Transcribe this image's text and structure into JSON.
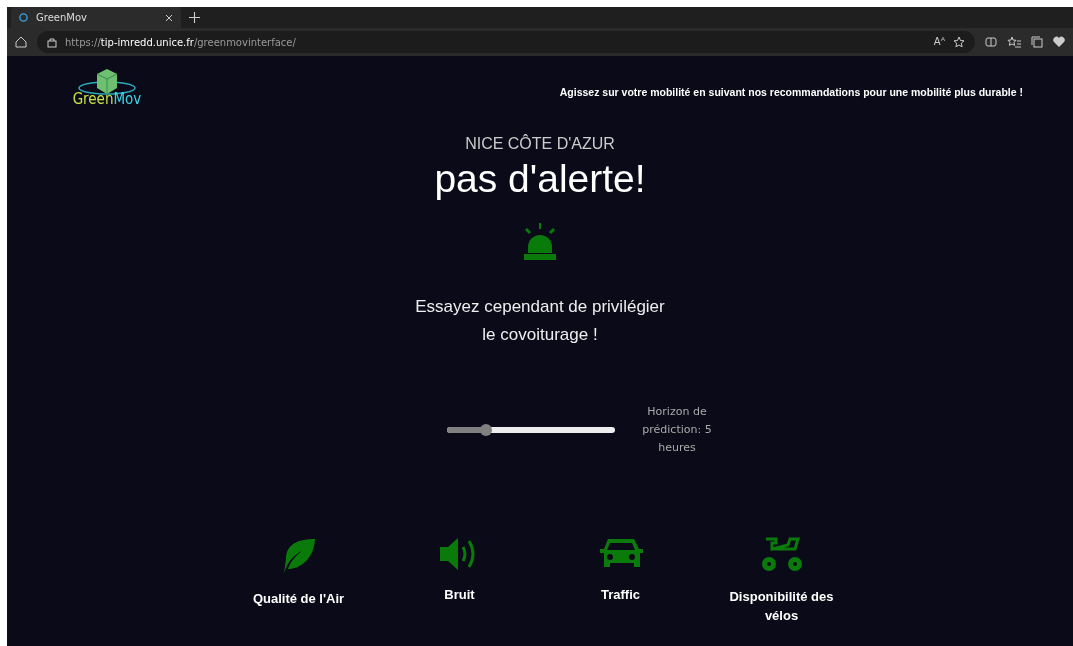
{
  "browser": {
    "tab": {
      "title": "GreenMov"
    },
    "url": "https://**tip-imredd.unice.fr**/greenmovinterface/",
    "read_aloud": "Aᴬ"
  },
  "header": {
    "logo": {
      "parts": [
        "Green",
        "Mov"
      ]
    },
    "tagline": "Agissez sur votre mobilité en suivant nos recommandations pour une mobilité plus durable !"
  },
  "alert": {
    "region": "NICE CÔTE D'AZUR",
    "status": "pas d'alerte!",
    "color": "#0a7a0a",
    "advice_lines": [
      "Essayez cependant de privilégier",
      "le covoiturage !"
    ]
  },
  "horizon": {
    "level": 0.23,
    "label": "Horizon de prédiction: 5 heures"
  },
  "categories": [
    {
      "kind": "leaf",
      "label": "Qualité de l'Air"
    },
    {
      "kind": "speaker",
      "label": "Bruit"
    },
    {
      "kind": "car",
      "label": "Traffic"
    },
    {
      "kind": "bike",
      "label": "Disponibilité des vélos"
    }
  ]
}
